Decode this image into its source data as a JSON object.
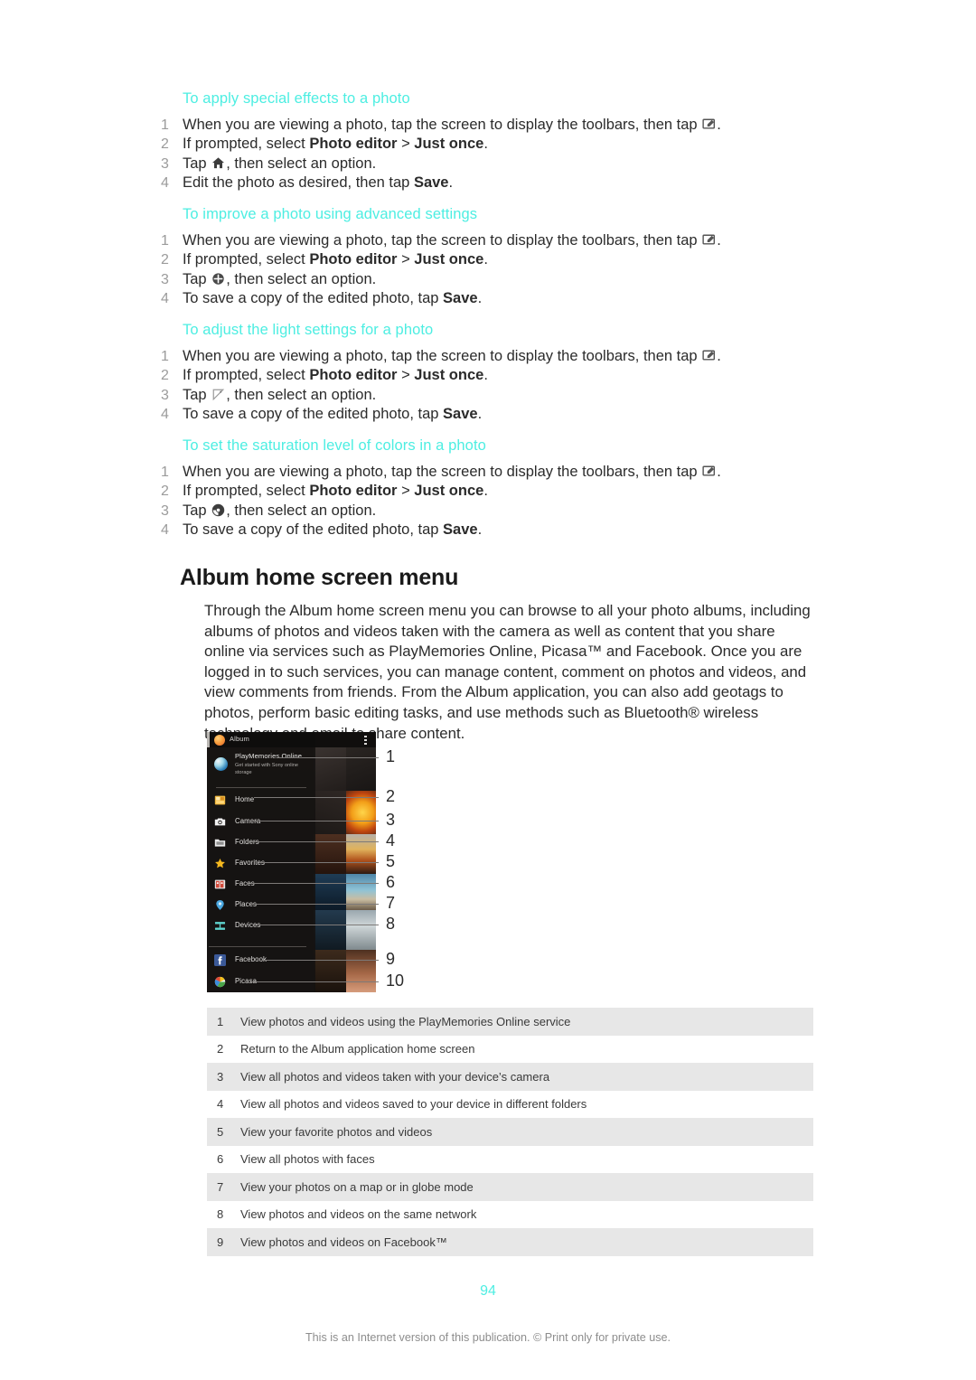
{
  "colors": {
    "heading_cyan": "#4deee2",
    "body_text": "#2b2b2b",
    "list_number": "#9b9b9b",
    "table_stripe": "#e7e7e7",
    "footer_text": "#8d8d8d"
  },
  "procedures": [
    {
      "title": "To apply special effects to a photo",
      "steps": [
        {
          "num": "1",
          "pre": "When you are viewing a photo, tap the screen to display the toolbars, then tap ",
          "icon": "edit-toolbar-icon",
          "post": "."
        },
        {
          "num": "2",
          "pre": "If prompted, select ",
          "bold1": "Photo editor",
          "mid": " > ",
          "bold2": "Just once",
          "post": "."
        },
        {
          "num": "3",
          "pre": "Tap ",
          "icon": "special-effects-icon",
          "post": ", then select an option."
        },
        {
          "num": "4",
          "pre": "Edit the photo as desired, then tap ",
          "bold1": "Save",
          "post": "."
        }
      ]
    },
    {
      "title": "To improve a photo using advanced settings",
      "steps": [
        {
          "num": "1",
          "pre": "When you are viewing a photo, tap the screen to display the toolbars, then tap ",
          "icon": "edit-toolbar-icon",
          "post": "."
        },
        {
          "num": "2",
          "pre": "If prompted, select ",
          "bold1": "Photo editor",
          "mid": " > ",
          "bold2": "Just once",
          "post": "."
        },
        {
          "num": "3",
          "pre": "Tap ",
          "icon": "advanced-settings-icon",
          "post": ", then select an option."
        },
        {
          "num": "4",
          "pre": "To save a copy of the edited photo, tap ",
          "bold1": "Save",
          "post": "."
        }
      ]
    },
    {
      "title": "To adjust the light settings for a photo",
      "steps": [
        {
          "num": "1",
          "pre": "When you are viewing a photo, tap the screen to display the toolbars, then tap ",
          "icon": "edit-toolbar-icon",
          "post": "."
        },
        {
          "num": "2",
          "pre": "If prompted, select ",
          "bold1": "Photo editor",
          "mid": " > ",
          "bold2": "Just once",
          "post": "."
        },
        {
          "num": "3",
          "pre": "Tap ",
          "icon": "light-settings-icon",
          "post": ", then select an option."
        },
        {
          "num": "4",
          "pre": "To save a copy of the edited photo, tap ",
          "bold1": "Save",
          "post": "."
        }
      ]
    },
    {
      "title": "To set the saturation level of colors in a photo",
      "steps": [
        {
          "num": "1",
          "pre": "When you are viewing a photo, tap the screen to display the toolbars, then tap ",
          "icon": "edit-toolbar-icon",
          "post": "."
        },
        {
          "num": "2",
          "pre": "If prompted, select ",
          "bold1": "Photo editor",
          "mid": " > ",
          "bold2": "Just once",
          "post": "."
        },
        {
          "num": "3",
          "pre": "Tap ",
          "icon": "saturation-icon",
          "post": ", then select an option."
        },
        {
          "num": "4",
          "pre": "To save a copy of the edited photo, tap ",
          "bold1": "Save",
          "post": "."
        }
      ]
    }
  ],
  "section": {
    "heading": "Album home screen menu",
    "intro": "Through the Album home screen menu you can browse to all your photo albums, including albums of photos and videos taken with the camera as well as content that you share online via services such as PlayMemories Online, Picasa™ and Facebook. Once you are logged in to such services, you can manage content, comment on photos and videos, and view comments from friends. From the Album application, you can also add geotags to photos, perform basic editing tasks, and use methods such as Bluetooth® wireless technology and email to share content."
  },
  "figure": {
    "app_title": "Album",
    "promo": {
      "title": "PlayMemories Online",
      "subtitle": "Get started with Sony online storage"
    },
    "menu_items": [
      {
        "label": "Home",
        "icon": "home-album-icon"
      },
      {
        "label": "Camera",
        "icon": "camera-icon"
      },
      {
        "label": "Folders",
        "icon": "folder-icon"
      },
      {
        "label": "Favorites",
        "icon": "star-icon"
      },
      {
        "label": "Faces",
        "icon": "faces-icon"
      },
      {
        "label": "Places",
        "icon": "place-pin-icon"
      },
      {
        "label": "Devices",
        "icon": "devices-icon"
      },
      {
        "label": "Facebook",
        "icon": "facebook-icon"
      },
      {
        "label": "Picasa",
        "icon": "picasa-icon"
      }
    ],
    "callouts": [
      "1",
      "2",
      "3",
      "4",
      "5",
      "6",
      "7",
      "8",
      "9",
      "10"
    ]
  },
  "legend": {
    "rows": [
      {
        "num": "1",
        "text": "View photos and videos using the PlayMemories Online service"
      },
      {
        "num": "2",
        "text": "Return to the Album application home screen"
      },
      {
        "num": "3",
        "text": "View all photos and videos taken with your device’s camera"
      },
      {
        "num": "4",
        "text": "View all photos and videos saved to your device in different folders"
      },
      {
        "num": "5",
        "text": "View your favorite photos and videos"
      },
      {
        "num": "6",
        "text": "View all photos with faces"
      },
      {
        "num": "7",
        "text": "View your photos on a map or in globe mode"
      },
      {
        "num": "8",
        "text": "View photos and videos on the same network"
      },
      {
        "num": "9",
        "text": "View photos and videos on Facebook™"
      }
    ]
  },
  "footer": {
    "page_number": "94",
    "notice": "This is an Internet version of this publication. © Print only for private use."
  }
}
